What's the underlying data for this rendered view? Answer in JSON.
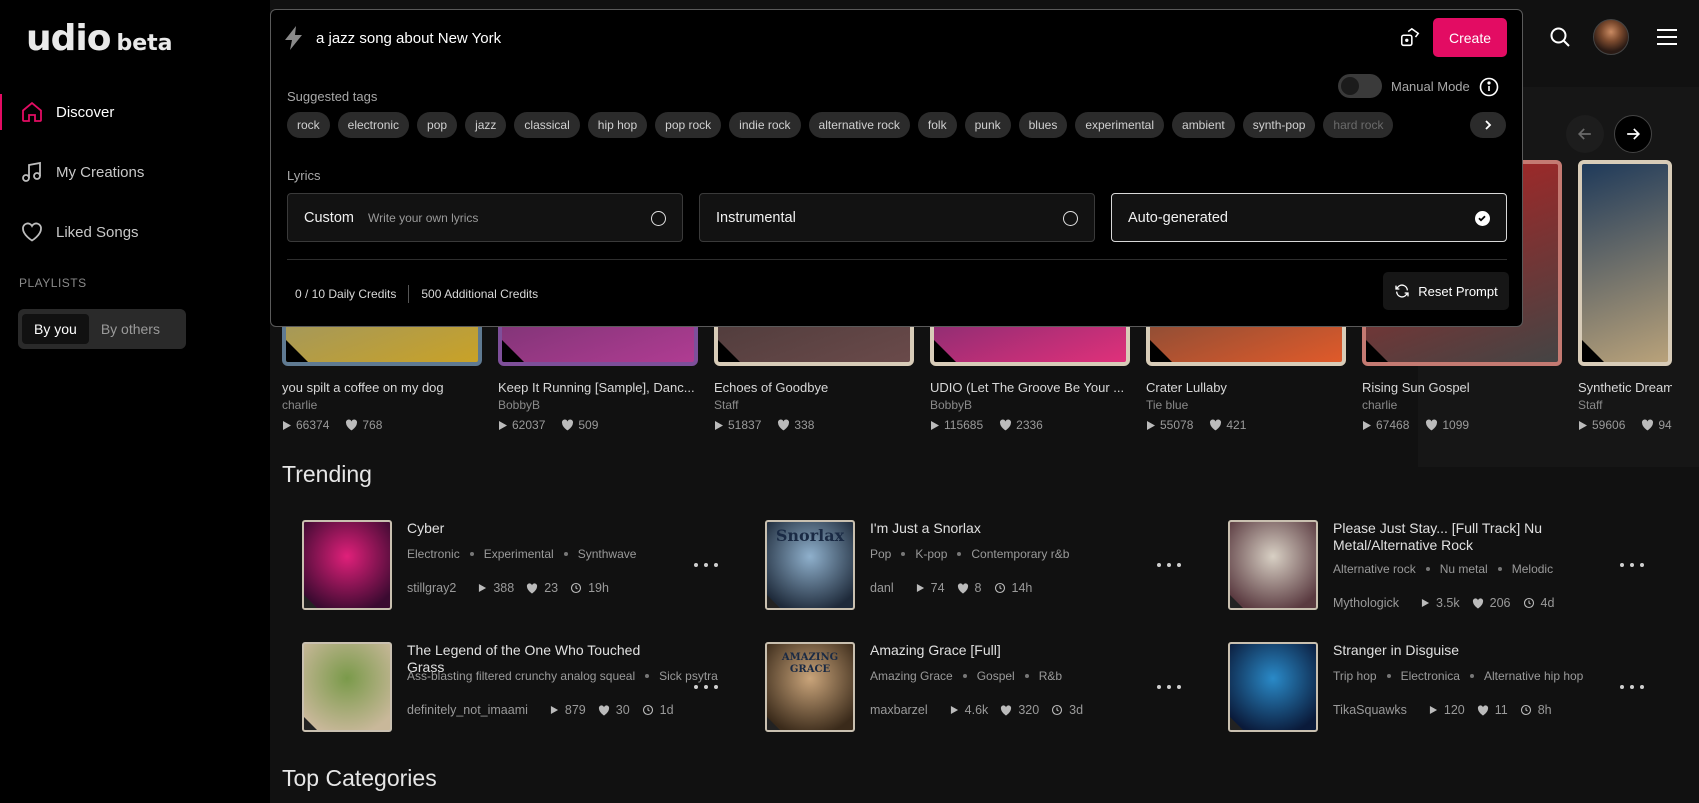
{
  "app": {
    "logo": "udio",
    "logo_suffix": "beta"
  },
  "sidebar": {
    "items": [
      {
        "label": "Discover",
        "icon": "home-icon"
      },
      {
        "label": "My Creations",
        "icon": "music-note-icon"
      },
      {
        "label": "Liked Songs",
        "icon": "heart-icon"
      }
    ],
    "playlists_title": "PLAYLISTS",
    "playlist_tabs": [
      "By you",
      "By others"
    ]
  },
  "prompt": {
    "value": "a jazz song about New York",
    "create_label": "Create",
    "suggested_tags_label": "Suggested tags",
    "manual_mode_label": "Manual Mode",
    "tags": [
      "rock",
      "electronic",
      "pop",
      "jazz",
      "classical",
      "hip hop",
      "pop rock",
      "indie rock",
      "alternative rock",
      "folk",
      "punk",
      "blues",
      "experimental",
      "ambient",
      "synth-pop",
      "hard rock"
    ],
    "lyrics_label": "Lyrics",
    "lyrics_options": [
      {
        "title": "Custom",
        "subtitle": "Write your own lyrics",
        "selected": false
      },
      {
        "title": "Instrumental",
        "subtitle": "",
        "selected": false
      },
      {
        "title": "Auto-generated",
        "subtitle": "",
        "selected": true
      }
    ],
    "daily_credits": "0 / 10 Daily Credits",
    "additional_credits": "500 Additional Credits",
    "reset_label": "Reset Prompt"
  },
  "carousel": [
    {
      "title": "you spilt a coffee on my dog",
      "author": "charlie",
      "plays": "66374",
      "likes": "768",
      "colors": [
        "#6f8aa6",
        "#c9a227"
      ],
      "border": "#5f7a92"
    },
    {
      "title": "Keep It Running [Sample], Danc...",
      "author": "BobbyB",
      "plays": "62037",
      "likes": "509",
      "colors": [
        "#3e2a52",
        "#b03c92"
      ],
      "border": "#7e4f9a"
    },
    {
      "title": "Echoes of Goodbye",
      "author": "Staff",
      "plays": "51837",
      "likes": "338",
      "colors": [
        "#2d2a2a",
        "#6a4a4a"
      ],
      "border": "#d8ccb8"
    },
    {
      "title": "UDIO (Let The Groove Be Your ...",
      "author": "BobbyB",
      "plays": "115685",
      "likes": "2336",
      "colors": [
        "#1a2a6a",
        "#e0307a"
      ],
      "border": "#d8ccb8"
    },
    {
      "title": "Crater Lullaby",
      "author": "Tie blue",
      "plays": "55078",
      "likes": "421",
      "colors": [
        "#1b3c46",
        "#e05a2a"
      ],
      "border": "#d8ccb8"
    },
    {
      "title": "Rising Sun Gospel",
      "author": "charlie",
      "plays": "67468",
      "likes": "1099",
      "colors": [
        "#b22222",
        "#444444"
      ],
      "border": "#c47a72"
    },
    {
      "title": "Synthetic Dream",
      "author": "Staff",
      "plays": "59606",
      "likes": "94",
      "colors": [
        "#1f3a5a",
        "#b9a27a"
      ],
      "border": "#d8ccb8"
    }
  ],
  "trending_title": "Trending",
  "trending": [
    {
      "title": "Cyber",
      "tags": [
        "Electronic",
        "Experimental",
        "Synthwave"
      ],
      "user": "stillgray2",
      "plays": "388",
      "likes": "23",
      "age": "19h",
      "colors": [
        "#e0207a",
        "#3a0a30"
      ]
    },
    {
      "title": "I'm Just a Snorlax",
      "tags": [
        "Pop",
        "K-pop",
        "Contemporary r&b"
      ],
      "user": "danl",
      "plays": "74",
      "likes": "8",
      "age": "14h",
      "colors": [
        "#8fb0cc",
        "#1e2a3a"
      ],
      "art_text": "Snorlax"
    },
    {
      "title": "Please Just Stay... [Full Track] Nu Metal/Alternative Rock",
      "tags": [
        "Alternative rock",
        "Nu metal",
        "Melodic"
      ],
      "user": "Mythologick",
      "plays": "3.5k",
      "likes": "206",
      "age": "4d",
      "colors": [
        "#d8d0c4",
        "#5a3a40"
      ]
    },
    {
      "title": "The Legend of the One Who Touched Grass",
      "tags": [
        "Ass-blasting filtered crunchy analog squeal",
        "Sick psytra"
      ],
      "user": "definitely_not_imaami",
      "plays": "879",
      "likes": "30",
      "age": "1d",
      "colors": [
        "#7a9a4a",
        "#c9b89a"
      ]
    },
    {
      "title": "Amazing Grace [Full]",
      "tags": [
        "Amazing Grace",
        "Gospel",
        "R&b"
      ],
      "user": "maxbarzel",
      "plays": "4.6k",
      "likes": "320",
      "age": "3d",
      "colors": [
        "#c9a47a",
        "#3a2a1a"
      ],
      "art_text": "AMAZING GRACE"
    },
    {
      "title": "Stranger in Disguise",
      "tags": [
        "Trip hop",
        "Electronica",
        "Alternative hip hop"
      ],
      "user": "TikaSquawks",
      "plays": "120",
      "likes": "11",
      "age": "8h",
      "colors": [
        "#2a8ac8",
        "#0a1a3a"
      ]
    }
  ],
  "top_categories_title": "Top Categories",
  "colors": {
    "accent": "#e30c63",
    "background": "#111111",
    "sidebar": "#000000"
  }
}
